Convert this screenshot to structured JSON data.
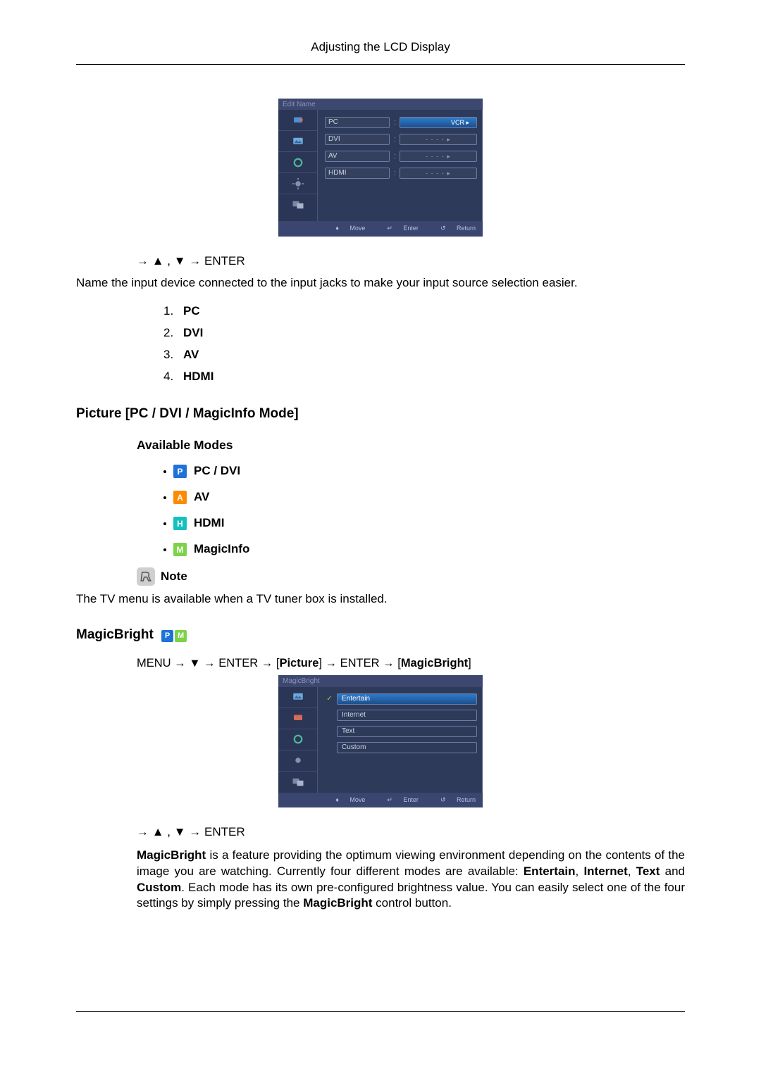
{
  "header": {
    "title": "Adjusting the LCD Display"
  },
  "osd1": {
    "title": "Edit Name",
    "rows": [
      {
        "label": "PC",
        "value": "VCR",
        "vcr": true
      },
      {
        "label": "DVI",
        "value": "- - - -   ▸"
      },
      {
        "label": "AV",
        "value": "- - - -   ▸"
      },
      {
        "label": "HDMI",
        "value": "- - - -   ▸"
      }
    ],
    "footer": {
      "move": "Move",
      "enter": "Enter",
      "return": "Return"
    }
  },
  "arrows1": "→ ▲ , ▼ → ENTER",
  "desc1": "Name the input device connected to the input jacks to make your input source selection easier.",
  "list1": [
    {
      "num": "1.",
      "label": "PC"
    },
    {
      "num": "2.",
      "label": "DVI"
    },
    {
      "num": "3.",
      "label": "AV"
    },
    {
      "num": "4.",
      "label": "HDMI"
    }
  ],
  "heading2": "Picture [PC / DVI / MagicInfo Mode]",
  "heading3": "Available Modes",
  "modes": [
    {
      "letter": "P",
      "cls": "P",
      "label": "PC / DVI"
    },
    {
      "letter": "A",
      "cls": "A",
      "label": "AV"
    },
    {
      "letter": "H",
      "cls": "H",
      "label": "HDMI"
    },
    {
      "letter": "M",
      "cls": "M",
      "label": "MagicInfo"
    }
  ],
  "note": {
    "label": "Note",
    "text": "The TV menu is available when a TV tuner box is installed."
  },
  "heading4": "MagicBright",
  "path": {
    "p1": "MENU → ▼ → ENTER → [",
    "b1": "Picture",
    "p2": "] → ENTER → [",
    "b2": "MagicBright",
    "p3": "]"
  },
  "osd2": {
    "title": "MagicBright",
    "options": [
      {
        "label": "Entertain",
        "active": true
      },
      {
        "label": "Internet",
        "active": false
      },
      {
        "label": "Text",
        "active": false
      },
      {
        "label": "Custom",
        "active": false
      }
    ],
    "footer": {
      "move": "Move",
      "enter": "Enter",
      "return": "Return"
    }
  },
  "arrows2": "→ ▲ , ▼ → ENTER",
  "mb": {
    "b0": "MagicBright",
    "t1": " is a feature providing the optimum viewing environment depending on the con­tents of the image you are watching. Currently four different modes are available: ",
    "b1": "Entertain",
    "t2": ", ",
    "b2": "Internet",
    "t3": ", ",
    "b3": "Text",
    "t4": " and ",
    "b4": "Custom",
    "t5": ". Each mode has its own pre-configured brightness value. You can easily select one of the four settings by simply pressing the ",
    "b5": "MagicBright",
    "t6": " control button."
  }
}
